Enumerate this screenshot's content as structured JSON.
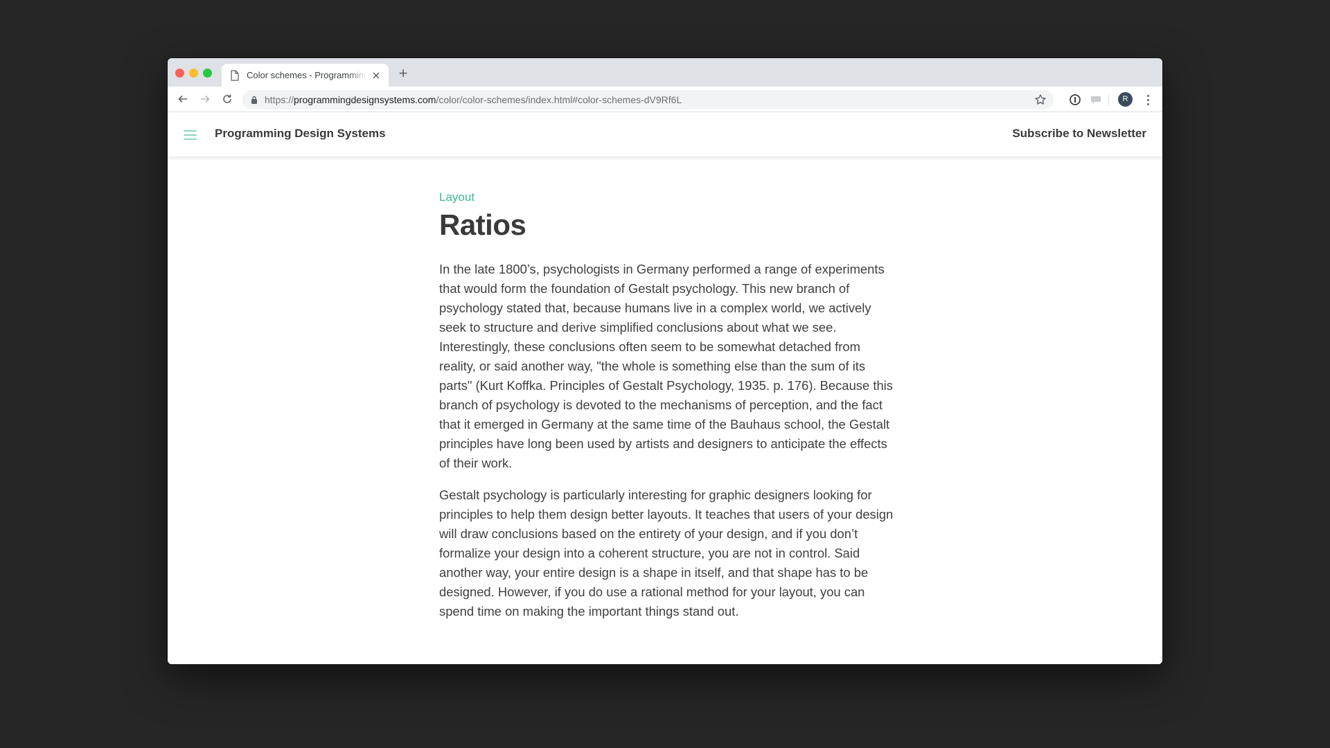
{
  "browser": {
    "tab": {
      "title": "Color schemes - Programming Design Systems",
      "icon": "document-icon",
      "close_icon": "close-icon"
    },
    "new_tab_label": "+",
    "nav": {
      "back_icon": "arrow-left-icon",
      "forward_icon": "arrow-right-icon",
      "reload_icon": "reload-icon"
    },
    "address_bar": {
      "secure_icon": "lock-icon",
      "url_scheme": "https://",
      "url_host": "programmingdesignsystems.com",
      "url_path": "/color/color-schemes/index.html#color-schemes-dV9Rf6L"
    },
    "toolbar_icons": [
      "bookmark-star-icon",
      "extension-info-icon",
      "extension-chat-icon"
    ],
    "profile_initial": "R"
  },
  "site": {
    "title": "Programming Design Systems",
    "menu_icon": "hamburger-icon",
    "subscribe_label": "Subscribe to Newsletter",
    "accent_color": "#3bb896"
  },
  "article": {
    "category": "Layout",
    "title": "Ratios",
    "paragraphs": [
      "In the late 1800’s, psychologists in Germany performed a range of experiments that would form the foundation of Gestalt psychology. This new branch of psychology stated that, because humans live in a complex world, we actively seek to structure and derive simplified conclusions about what we see. Interestingly, these conclusions often seem to be somewhat detached from reality, or said another way, \"the whole is something else than the sum of its parts\" (Kurt Koffka. Principles of Gestalt Psychology, 1935. p. 176). Because this branch of psychology is devoted to the mechanisms of perception, and the fact that it emerged in Germany at the same time of the Bauhaus school, the Gestalt principles have long been used by artists and designers to anticipate the effects of their work.",
      "Gestalt psychology is particularly interesting for graphic designers looking for principles to help them design better layouts. It teaches that users of your design will draw conclusions based on the entirety of your design, and if you don’t formalize your design into a coherent structure, you are not in control. Said another way, your entire design is a shape in itself, and that shape has to be designed. However, if you do use a rational method for your layout, you can spend time on making the important things stand out."
    ]
  }
}
